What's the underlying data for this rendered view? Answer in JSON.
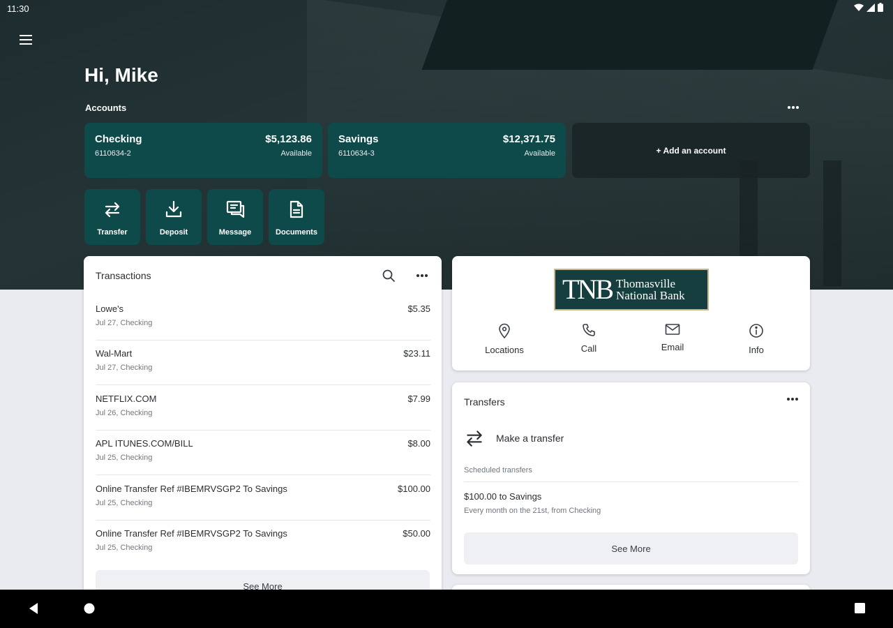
{
  "status_bar": {
    "time": "11:30"
  },
  "greeting": "Hi, Mike",
  "accounts": {
    "label": "Accounts",
    "items": [
      {
        "name": "Checking",
        "number": "6110634-2",
        "balance": "$5,123.86",
        "balance_label": "Available"
      },
      {
        "name": "Savings",
        "number": "6110634-3",
        "balance": "$12,371.75",
        "balance_label": "Available"
      }
    ],
    "add_label": "+ Add an account"
  },
  "quick_actions": [
    {
      "label": "Transfer",
      "icon": "transfer-icon"
    },
    {
      "label": "Deposit",
      "icon": "deposit-icon"
    },
    {
      "label": "Message",
      "icon": "message-icon"
    },
    {
      "label": "Documents",
      "icon": "document-icon"
    }
  ],
  "transactions": {
    "title": "Transactions",
    "items": [
      {
        "description": "Lowe's",
        "meta": "Jul 27, Checking",
        "amount": "$5.35"
      },
      {
        "description": "Wal-Mart",
        "meta": "Jul 27, Checking",
        "amount": "$23.11"
      },
      {
        "description": "NETFLIX.COM",
        "meta": "Jul 26, Checking",
        "amount": "$7.99"
      },
      {
        "description": "APL ITUNES.COM/BILL",
        "meta": "Jul 25, Checking",
        "amount": "$8.00"
      },
      {
        "description": "Online Transfer Ref #IBEMRVSGP2 To Savings",
        "meta": "Jul 25, Checking",
        "amount": "$100.00"
      },
      {
        "description": "Online Transfer Ref #IBEMRVSGP2 To Savings",
        "meta": "Jul 25, Checking",
        "amount": "$50.00"
      }
    ],
    "see_more": "See More"
  },
  "bank": {
    "logo_mark": "TNB",
    "logo_line1": "Thomasville",
    "logo_line2": "National Bank",
    "actions": [
      {
        "label": "Locations",
        "icon": "location-pin-icon"
      },
      {
        "label": "Call",
        "icon": "phone-icon"
      },
      {
        "label": "Email",
        "icon": "email-icon"
      },
      {
        "label": "Info",
        "icon": "info-icon"
      }
    ]
  },
  "transfers": {
    "title": "Transfers",
    "make_transfer": "Make a transfer",
    "scheduled_label": "Scheduled transfers",
    "scheduled": [
      {
        "title": "$100.00 to Savings",
        "detail": "Every month on the 21st, from Checking"
      }
    ],
    "see_more": "See More"
  },
  "colors": {
    "accent": "#0f4a4a",
    "hero_bg": "#1d2c2e",
    "page_bg": "#e9ebf0"
  }
}
